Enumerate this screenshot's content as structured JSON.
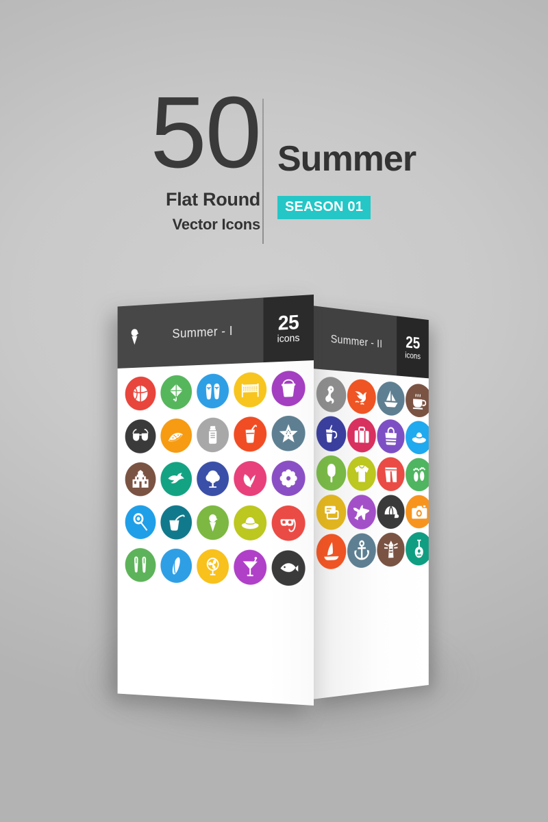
{
  "header": {
    "count": "50",
    "subtitle_line1": "Flat Round",
    "subtitle_line2": "Vector Icons",
    "title": "Summer",
    "badge": "SEASON 01",
    "badge_color": "#24c6c6",
    "text_color": "#333333"
  },
  "panels": [
    {
      "id": "panel-summer-1",
      "name": "Summer - I",
      "count_number": "25",
      "count_label": "icons",
      "header_bg": "#474747",
      "badge_bg": "#2b2b2b",
      "brand_icon": "ice-cream-cone-icon",
      "icons": [
        {
          "name": "beach-ball-icon",
          "color": "#e8453c"
        },
        {
          "name": "kite-icon",
          "color": "#56b65c"
        },
        {
          "name": "flip-flops-icon",
          "color": "#2e9fe5"
        },
        {
          "name": "volleyball-net-icon",
          "color": "#f7c51e"
        },
        {
          "name": "sand-bucket-icon",
          "color": "#a33fc0"
        },
        {
          "name": "sunglasses-icon",
          "color": "#3a3a3a"
        },
        {
          "name": "watermelon-icon",
          "color": "#f79b12"
        },
        {
          "name": "sunscreen-icon",
          "color": "#a8a8a8"
        },
        {
          "name": "juice-glass-icon",
          "color": "#f04d24"
        },
        {
          "name": "starfish-icon",
          "color": "#5d7f91"
        },
        {
          "name": "sandcastle-icon",
          "color": "#7a5343"
        },
        {
          "name": "seagull-icon",
          "color": "#13a383"
        },
        {
          "name": "tree-icon",
          "color": "#3a4fa8"
        },
        {
          "name": "leaves-icon",
          "color": "#e8407a"
        },
        {
          "name": "flower-icon",
          "color": "#8a4fc4"
        },
        {
          "name": "lollipop-icon",
          "color": "#1f9fe8"
        },
        {
          "name": "coconut-drink-icon",
          "color": "#11798c"
        },
        {
          "name": "ice-cream-cone-icon",
          "color": "#7db842"
        },
        {
          "name": "sun-hat-icon",
          "color": "#bcc71f"
        },
        {
          "name": "snorkel-mask-icon",
          "color": "#ea4b45"
        },
        {
          "name": "flippers-icon",
          "color": "#5db359"
        },
        {
          "name": "surfboard-icon",
          "color": "#2e9fe5"
        },
        {
          "name": "fan-icon",
          "color": "#f8c11c"
        },
        {
          "name": "cocktail-icon",
          "color": "#b040c8"
        },
        {
          "name": "fish-icon",
          "color": "#3a3a3a"
        }
      ]
    },
    {
      "id": "panel-summer-2",
      "name": "Summer - II",
      "count_number": "25",
      "count_label": "icons",
      "header_bg": "#414141",
      "badge_bg": "#272727",
      "icons": [
        {
          "name": "seahorse-icon",
          "color": "#8c8c8c"
        },
        {
          "name": "dolphin-icon",
          "color": "#ee5424"
        },
        {
          "name": "sailboat-icon",
          "color": "#5d7f91"
        },
        {
          "name": "coffee-cup-icon",
          "color": "#7a5343"
        },
        {
          "name": "soda-drink-icon",
          "color": "#3a3f9e"
        },
        {
          "name": "suitcase-icon",
          "color": "#d8305f"
        },
        {
          "name": "handbag-icon",
          "color": "#7d4fc4"
        },
        {
          "name": "beach-hat-icon",
          "color": "#1fa9ef"
        },
        {
          "name": "popsicle-icon",
          "color": "#78b846"
        },
        {
          "name": "tshirt-icon",
          "color": "#bcc71f"
        },
        {
          "name": "shorts-icon",
          "color": "#ea4b45"
        },
        {
          "name": "footprints-icon",
          "color": "#4fb560"
        },
        {
          "name": "ticket-icon",
          "color": "#e0b41e"
        },
        {
          "name": "airplane-icon",
          "color": "#a350c8"
        },
        {
          "name": "cap-icon",
          "color": "#3a3a3a"
        },
        {
          "name": "camera-icon",
          "color": "#f7941e"
        },
        {
          "name": "windsurf-icon",
          "color": "#ee5424"
        },
        {
          "name": "anchor-icon",
          "color": "#5d7f91"
        },
        {
          "name": "lighthouse-icon",
          "color": "#7a5343"
        },
        {
          "name": "guitar-icon",
          "color": "#0f9e82"
        }
      ]
    }
  ]
}
